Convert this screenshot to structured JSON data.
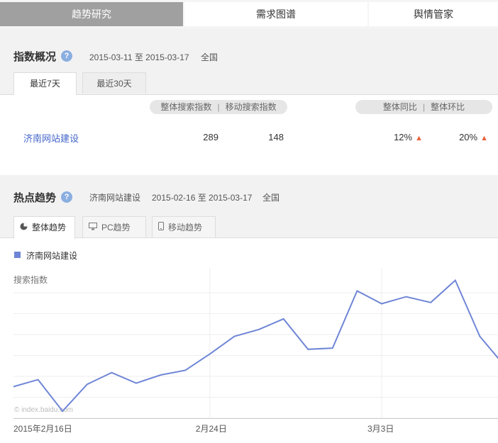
{
  "nav": {
    "tabs": [
      {
        "label": "趋势研究",
        "active": true
      },
      {
        "label": "需求图谱",
        "active": false
      },
      {
        "label": "舆情管家",
        "active": false
      }
    ]
  },
  "overview": {
    "title": "指数概况",
    "date_range": "2015-03-11 至 2015-03-17",
    "region": "全国",
    "tabs": [
      {
        "label": "最近7天",
        "active": true
      },
      {
        "label": "最近30天",
        "active": false
      }
    ],
    "headers": {
      "overall_search": "整体搜索指数",
      "separator": "|",
      "mobile_search": "移动搜索指数",
      "yoy": "整体同比",
      "mom": "整体环比"
    },
    "row": {
      "keyword": "济南网站建设",
      "overall_index": "289",
      "mobile_index": "148",
      "yoy": "12%",
      "mom": "20%"
    },
    "trend_color": "#e8643c"
  },
  "hot_trend": {
    "title": "热点趋势",
    "keyword": "济南网站建设",
    "date_range": "2015-02-16 至 2015-03-17",
    "region": "全国",
    "tabs": [
      {
        "label": "整体趋势",
        "icon": "pie-icon",
        "active": true
      },
      {
        "label": "PC趋势",
        "icon": "monitor-icon",
        "active": false
      },
      {
        "label": "移动趋势",
        "icon": "phone-icon",
        "active": false
      }
    ]
  },
  "chart_data": {
    "type": "line",
    "ylabel": "搜索指数",
    "watermark": "© index.baidu.com",
    "series": [
      {
        "name": "济南网站建设",
        "color": "#6f86d6",
        "values": [
          207,
          213,
          186,
          209,
          219,
          210,
          217,
          221,
          235,
          250,
          256,
          265,
          239,
          240,
          289,
          278,
          284,
          279,
          298,
          250,
          225
        ]
      }
    ],
    "x_tick_labels": [
      {
        "label": "2015年2月16日",
        "index": 0
      },
      {
        "label": "2月24日",
        "index": 8
      },
      {
        "label": "3月3日",
        "index": 15
      }
    ],
    "dates": [
      "2015-02-16",
      "2015-02-17",
      "2015-02-18",
      "2015-02-19",
      "2015-02-20",
      "2015-02-21",
      "2015-02-22",
      "2015-02-23",
      "2015-02-24",
      "2015-02-25",
      "2015-02-26",
      "2015-02-27",
      "2015-02-28",
      "2015-03-01",
      "2015-03-02",
      "2015-03-03",
      "2015-03-04",
      "2015-03-05",
      "2015-03-06",
      "2015-03-07",
      "2015-03-08"
    ],
    "ylim": [
      180,
      305
    ],
    "grid": true,
    "legend": "top-left"
  }
}
